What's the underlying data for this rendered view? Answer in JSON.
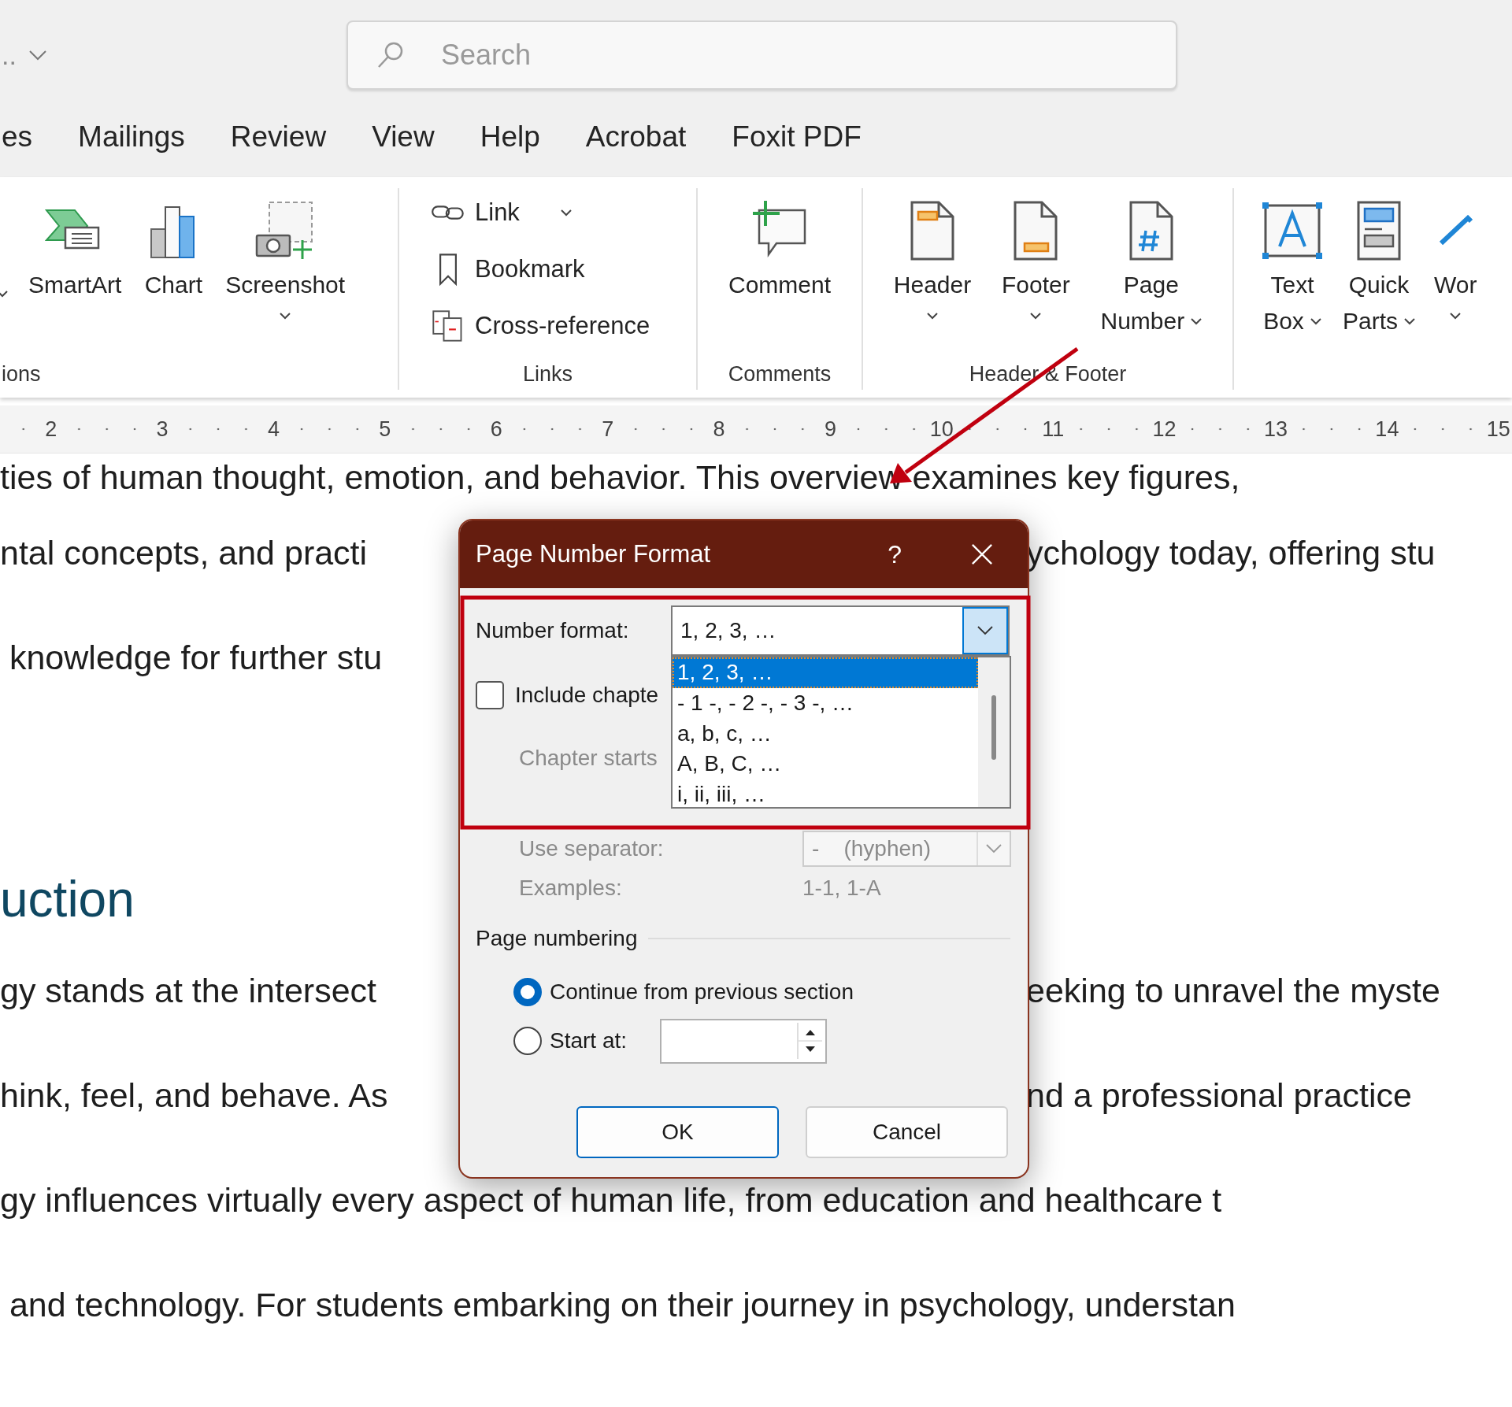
{
  "quick_access": {
    "label": ".."
  },
  "search": {
    "placeholder": "Search"
  },
  "tabs": [
    {
      "label": "es",
      "selected": false
    },
    {
      "label": "Mailings",
      "selected": false
    },
    {
      "label": "Review",
      "selected": false
    },
    {
      "label": "View",
      "selected": false
    },
    {
      "label": "Help",
      "selected": false
    },
    {
      "label": "Acrobat",
      "selected": false
    },
    {
      "label": "Foxit PDF",
      "selected": false
    }
  ],
  "ribbon": {
    "groups": [
      {
        "label": "ions",
        "lead_dropdown": true,
        "items": [
          {
            "kind": "large",
            "lines": [
              "SmartArt"
            ],
            "dropdown": false
          },
          {
            "kind": "large",
            "lines": [
              "Chart"
            ],
            "dropdown": false
          },
          {
            "kind": "large",
            "lines": [
              "Screenshot"
            ],
            "dropdown": true
          }
        ]
      },
      {
        "label": "Links",
        "items": [
          {
            "kind": "small",
            "lines": [
              "Link"
            ],
            "dropdown": true
          },
          {
            "kind": "small",
            "lines": [
              "Bookmark"
            ],
            "dropdown": false
          },
          {
            "kind": "small",
            "lines": [
              "Cross-reference"
            ],
            "dropdown": false
          }
        ]
      },
      {
        "label": "Comments",
        "items": [
          {
            "kind": "large",
            "lines": [
              "Comment"
            ],
            "dropdown": false
          }
        ]
      },
      {
        "label": "Header & Footer",
        "items": [
          {
            "kind": "large",
            "lines": [
              "Header"
            ],
            "dropdown": true
          },
          {
            "kind": "large",
            "lines": [
              "Footer"
            ],
            "dropdown": true
          },
          {
            "kind": "large",
            "lines": [
              "Page",
              "Number"
            ],
            "dropdown": true
          }
        ]
      },
      {
        "items": [
          {
            "kind": "large",
            "lines": [
              "Text",
              "Box"
            ],
            "dropdown": true
          },
          {
            "kind": "large",
            "lines": [
              "Quick",
              "Parts"
            ],
            "dropdown": true
          },
          {
            "kind": "large",
            "lines": [
              "Wor"
            ],
            "dropdown": true
          }
        ]
      }
    ]
  },
  "ruler": {
    "numbers": [
      "2",
      "3",
      "4",
      "5",
      "6",
      "7",
      "8",
      "9",
      "10",
      "11",
      "12",
      "13",
      "14",
      "15"
    ]
  },
  "document": {
    "lines": [
      {
        "kind": "body",
        "left": "ties of human thought, emotion, and behavior. This overview examines key figures,"
      },
      {
        "kind": "body",
        "left": "ntal concepts, and practi",
        "right": "ychology today, offering stu"
      },
      {
        "kind": "body",
        "left": " knowledge for further stu"
      },
      {
        "kind": "heading",
        "left": "uction"
      },
      {
        "kind": "body",
        "left": "gy stands at the intersect",
        "right": "eeking to unravel the myste"
      },
      {
        "kind": "body",
        "left": "hink, feel, and behave. As",
        "right": "nd a professional practice"
      },
      {
        "kind": "body",
        "left": "gy influences virtually every aspect of human life, from education and healthcare t"
      },
      {
        "kind": "body",
        "left": " and technology. For students embarking on their journey in psychology, understan"
      }
    ]
  },
  "dialog": {
    "title": "Page Number Format",
    "help": "?",
    "number_format": {
      "label": "Number format:",
      "value": "1, 2, 3, …",
      "expanded": true,
      "options": [
        {
          "label": "1, 2, 3, …",
          "selected": true
        },
        {
          "label": "- 1 -, - 2 -, - 3 -, …",
          "selected": false
        },
        {
          "label": "a, b, c, …",
          "selected": false
        },
        {
          "label": "A, B, C, …",
          "selected": false
        },
        {
          "label": "i, ii, iii, …",
          "selected": false
        }
      ]
    },
    "include_chapter": {
      "label": "Include chapte",
      "checked": false
    },
    "chapter_starts": {
      "label": "Chapter starts",
      "disabled": true
    },
    "separator": {
      "label": "Use separator:",
      "value": "-    (hyphen)",
      "disabled": true
    },
    "examples": {
      "label": "Examples:",
      "value": "1-1, 1-A",
      "disabled": true
    },
    "page_numbering": {
      "heading": "Page numbering",
      "options": [
        {
          "label": "Continue from previous section",
          "selected": true
        },
        {
          "label": "Start at:",
          "selected": false
        }
      ]
    },
    "buttons": [
      {
        "label": "OK",
        "default": true
      },
      {
        "label": "Cancel",
        "default": false
      }
    ]
  }
}
